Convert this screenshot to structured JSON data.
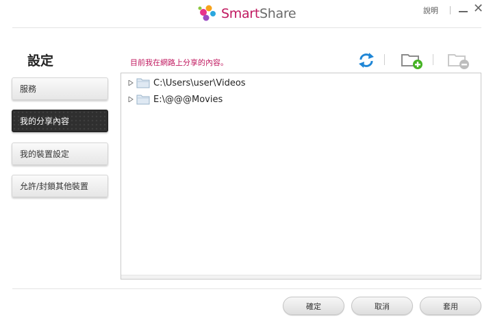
{
  "app": {
    "logo_smart": "Smart",
    "logo_share": "Share",
    "help_label": "說明"
  },
  "sidebar": {
    "title": "設定",
    "items": [
      {
        "label": "服務",
        "active": false
      },
      {
        "label": "我的分享內容",
        "active": true
      },
      {
        "label": "我的裝置設定",
        "active": false
      },
      {
        "label": "允許/封鎖其他裝置",
        "active": false
      }
    ]
  },
  "content": {
    "description": "目前我在網路上分享的內容。",
    "tools": [
      "refresh-icon",
      "add-folder-icon",
      "remove-folder-icon"
    ],
    "folders": [
      {
        "path": "C:\\Users\\user\\Videos"
      },
      {
        "path": "E:\\@@@Movies"
      }
    ]
  },
  "footer": {
    "confirm_label": "確定",
    "cancel_label": "取消",
    "apply_label": "套用"
  },
  "colors": {
    "accent": "#c0185f",
    "refresh": "#1f86d6",
    "add_green": "#45b324"
  }
}
